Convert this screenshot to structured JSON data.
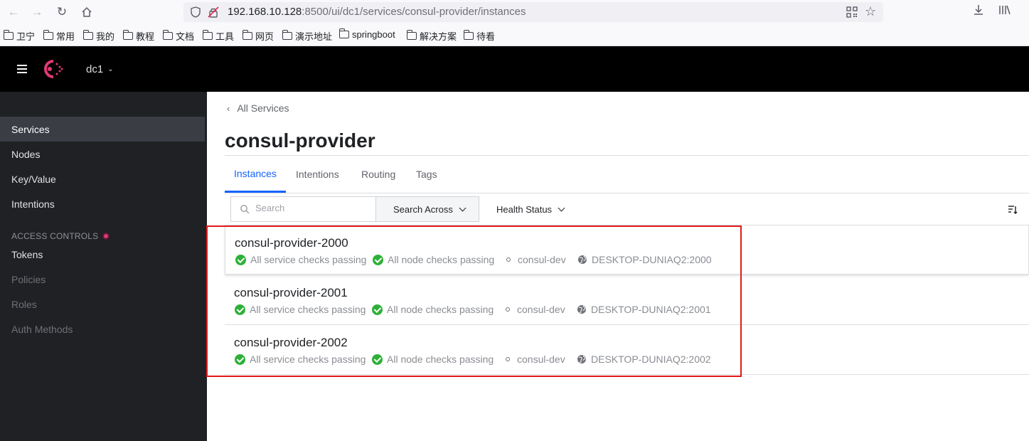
{
  "browser": {
    "url_host": "192.168.10.128",
    "url_rest": ":8500/ui/dc1/services/consul-provider/instances",
    "icons": [
      "back-icon",
      "forward-icon",
      "reload-icon",
      "home-icon",
      "shield-icon",
      "lock-icon",
      "qr-code-icon",
      "star-icon",
      "download-icon",
      "library-icon"
    ],
    "bookmarks": [
      "卫宁",
      "常用",
      "我的",
      "教程",
      "文档",
      "工具",
      "网页",
      "演示地址",
      "springboot",
      "解决方案",
      "待看"
    ]
  },
  "header": {
    "datacenter": "dc1"
  },
  "sidebar": {
    "items": [
      {
        "label": "Services",
        "active": true
      },
      {
        "label": "Nodes"
      },
      {
        "label": "Key/Value"
      },
      {
        "label": "Intentions"
      }
    ],
    "access_heading": "ACCESS CONTROLS",
    "access_items": [
      {
        "label": "Tokens",
        "disabled": false
      },
      {
        "label": "Policies",
        "disabled": true
      },
      {
        "label": "Roles",
        "disabled": true
      },
      {
        "label": "Auth Methods",
        "disabled": true
      }
    ]
  },
  "main": {
    "breadcrumb": "All Services",
    "title": "consul-provider",
    "tabs": [
      "Instances",
      "Intentions",
      "Routing",
      "Tags"
    ],
    "active_tab": "Instances",
    "search": {
      "placeholder": "Search",
      "across_label": "Search Across"
    },
    "health_label": "Health Status",
    "instances": [
      {
        "name": "consul-provider-2000",
        "service_checks": "All service checks passing",
        "node_checks": "All node checks passing",
        "node": "consul-dev",
        "address": "DESKTOP-DUNIAQ2:2000"
      },
      {
        "name": "consul-provider-2001",
        "service_checks": "All service checks passing",
        "node_checks": "All node checks passing",
        "node": "consul-dev",
        "address": "DESKTOP-DUNIAQ2:2001"
      },
      {
        "name": "consul-provider-2002",
        "service_checks": "All service checks passing",
        "node_checks": "All node checks passing",
        "node": "consul-dev",
        "address": "DESKTOP-DUNIAQ2:2002"
      }
    ]
  },
  "colors": {
    "accent": "#1563ff",
    "pass": "#2eb039",
    "brand": "#e03875",
    "highlight": "#e21919"
  }
}
